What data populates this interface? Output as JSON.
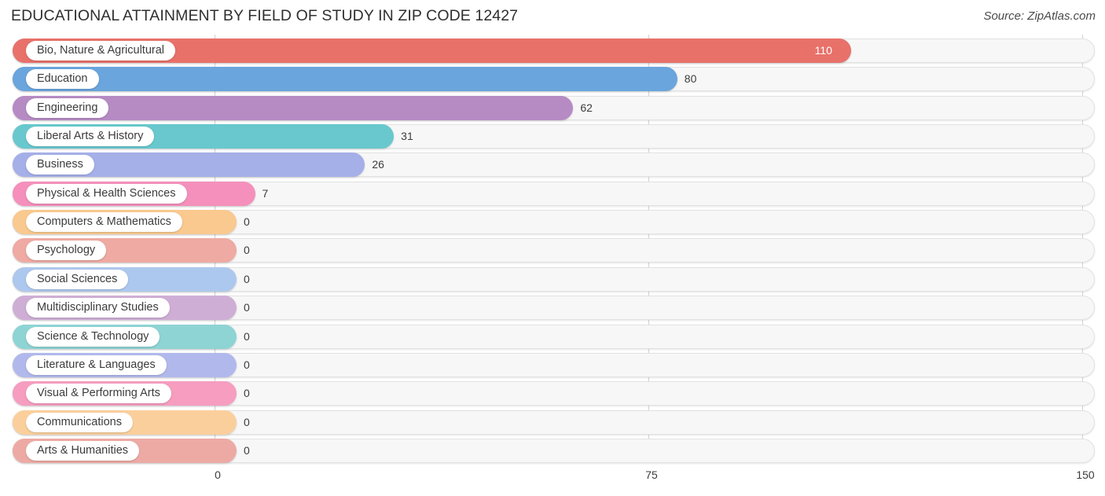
{
  "header": {
    "title": "EDUCATIONAL ATTAINMENT BY FIELD OF STUDY IN ZIP CODE 12427",
    "source": "Source: ZipAtlas.com"
  },
  "chart_data": {
    "type": "bar",
    "orientation": "horizontal",
    "title": "EDUCATIONAL ATTAINMENT BY FIELD OF STUDY IN ZIP CODE 12427",
    "xlabel": "",
    "ylabel": "",
    "xlim": [
      0,
      150
    ],
    "xticks": [
      0,
      75,
      150
    ],
    "xtick_labels": [
      "0",
      "75",
      "150"
    ],
    "grid": true,
    "legend": "none",
    "categories": [
      "Bio, Nature & Agricultural",
      "Education",
      "Engineering",
      "Liberal Arts & History",
      "Business",
      "Physical & Health Sciences",
      "Computers & Mathematics",
      "Psychology",
      "Social Sciences",
      "Multidisciplinary Studies",
      "Science & Technology",
      "Literature & Languages",
      "Visual & Performing Arts",
      "Communications",
      "Arts & Humanities"
    ],
    "values": [
      110,
      80,
      62,
      31,
      26,
      7,
      0,
      0,
      0,
      0,
      0,
      0,
      0,
      0,
      0
    ],
    "value_labels": [
      "110",
      "80",
      "62",
      "31",
      "26",
      "7",
      "0",
      "0",
      "0",
      "0",
      "0",
      "0",
      "0",
      "0",
      "0"
    ],
    "colors": [
      "#e8716a",
      "#6aa5dd",
      "#b68bc4",
      "#68c8ce",
      "#a5afe8",
      "#f490bb",
      "#f9c98f",
      "#eeaaa3",
      "#adc8ee",
      "#cfaed6",
      "#8ed4d4",
      "#b1b9ec",
      "#f69dc0",
      "#fbcf9c",
      "#edaaa4"
    ]
  },
  "axis": {
    "ticks": [
      {
        "label": "0",
        "value": 0
      },
      {
        "label": "75",
        "value": 75
      },
      {
        "label": "150",
        "value": 150
      }
    ]
  }
}
